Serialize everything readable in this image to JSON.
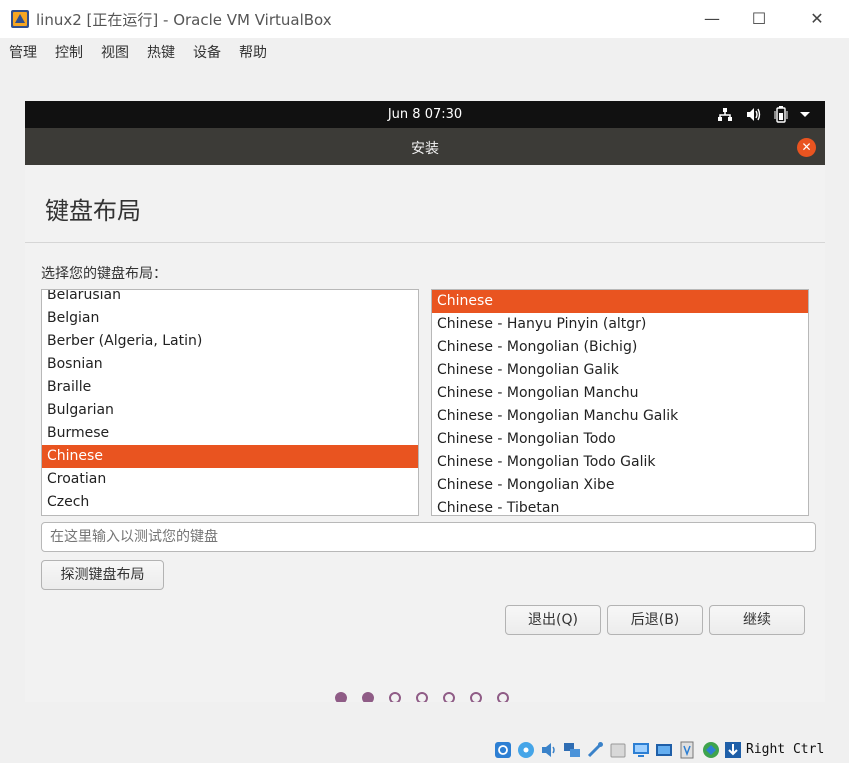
{
  "window": {
    "title": "linux2 [正在运行] - Oracle VM VirtualBox",
    "controls": {
      "minimize": "—",
      "maximize": "☐",
      "close": "✕"
    }
  },
  "menubar": {
    "items": [
      "管理",
      "控制",
      "视图",
      "热键",
      "设备",
      "帮助"
    ]
  },
  "vm": {
    "topbar": {
      "clock": "Jun 8  07:30"
    },
    "header": {
      "title": "安装",
      "close_glyph": "✕"
    },
    "page": {
      "heading": "键盘布局",
      "prompt": "选择您的键盘布局：",
      "layouts": [
        "Belarusian",
        "Belgian",
        "Berber (Algeria, Latin)",
        "Bosnian",
        "Braille",
        "Bulgarian",
        "Burmese",
        "Chinese",
        "Croatian",
        "Czech"
      ],
      "selected_layout_index": 7,
      "variants": [
        "Chinese",
        "Chinese - Hanyu Pinyin (altgr)",
        "Chinese - Mongolian (Bichig)",
        "Chinese - Mongolian Galik",
        "Chinese - Mongolian Manchu",
        "Chinese - Mongolian Manchu Galik",
        "Chinese - Mongolian Todo",
        "Chinese - Mongolian Todo Galik",
        "Chinese - Mongolian Xibe",
        "Chinese - Tibetan"
      ],
      "selected_variant_index": 0,
      "test_input_placeholder": "在这里输入以测试您的键盘",
      "detect_button": "探测键盘布局",
      "quit_button": "退出(Q)",
      "back_button": "后退(B)",
      "continue_button": "继续"
    },
    "progress": {
      "total_steps": 7,
      "completed_steps": 2
    }
  },
  "statusbar": {
    "host_key": "Right Ctrl"
  },
  "colors": {
    "accent": "#e95420",
    "header": "#3c3b37",
    "topbar": "#111111",
    "progress_dot": "#8f5c86"
  }
}
